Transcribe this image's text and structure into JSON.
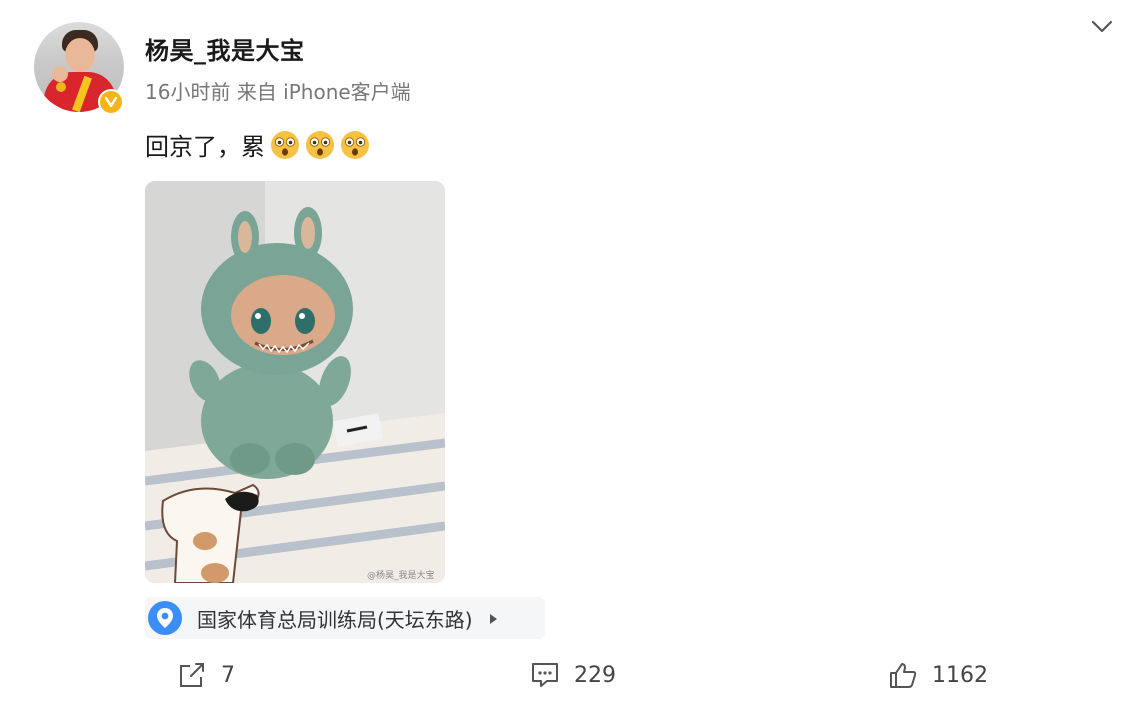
{
  "user": {
    "name": "杨昊_我是大宝",
    "time": "16小时前",
    "source": "来自 iPhone客户端"
  },
  "post": {
    "text": "回京了，累",
    "emojis": [
      "shocked-emoji",
      "shocked-emoji",
      "shocked-emoji"
    ]
  },
  "location": {
    "label": "国家体育总局训练局(天坛东路)"
  },
  "actions": {
    "repost_count": "7",
    "comment_count": "229",
    "like_count": "1162"
  },
  "colors": {
    "verify_badge": "#f6b417",
    "location_pin": "#3b8ef6",
    "text_primary": "#1a1a1a",
    "text_secondary": "#777777"
  }
}
